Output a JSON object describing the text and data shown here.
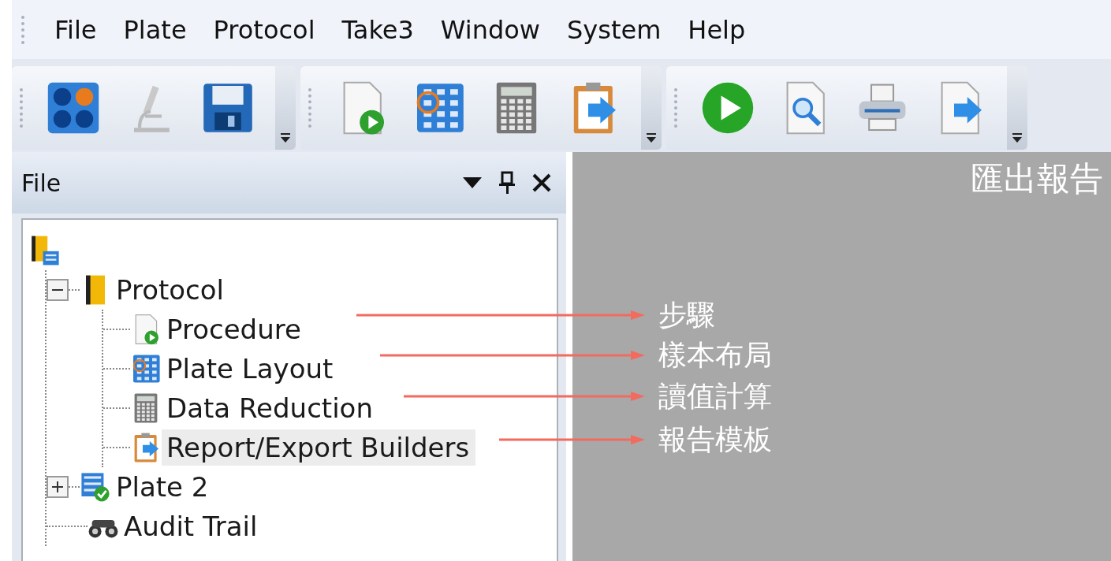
{
  "menu": [
    {
      "label": "File"
    },
    {
      "label": "Plate"
    },
    {
      "label": "Protocol"
    },
    {
      "label": "Take3"
    },
    {
      "label": "Window"
    },
    {
      "label": "System"
    },
    {
      "label": "Help"
    }
  ],
  "toolbar": [
    {
      "items": [
        {
          "kind": "wells"
        },
        {
          "kind": "microscope"
        },
        {
          "kind": "save"
        }
      ]
    },
    {
      "items": [
        {
          "kind": "procedure"
        },
        {
          "kind": "layout"
        },
        {
          "kind": "calculator"
        },
        {
          "kind": "clipboard"
        }
      ]
    },
    {
      "items": [
        {
          "kind": "play"
        },
        {
          "kind": "preview"
        },
        {
          "kind": "printer"
        },
        {
          "kind": "export"
        }
      ]
    }
  ],
  "panel": {
    "title": "File"
  },
  "tree": {
    "kind": "root",
    "children": [
      {
        "label": "Protocol",
        "kind": "folder",
        "expanded": true,
        "selected": false,
        "children": [
          {
            "label": "Procedure",
            "kind": "procedure",
            "selected": false
          },
          {
            "label": "Plate Layout",
            "kind": "layout",
            "selected": false
          },
          {
            "label": "Data Reduction",
            "kind": "calculator",
            "selected": false
          },
          {
            "label": "Report/Export Builders",
            "kind": "clipboard",
            "selected": true
          }
        ]
      },
      {
        "label": "Plate 2",
        "kind": "plate",
        "expanded": false,
        "selected": false
      },
      {
        "label": "Audit Trail",
        "kind": "binoculars",
        "selected": false
      }
    ]
  },
  "header_note": "匯出報告",
  "callouts": [
    {
      "label": "步驟"
    },
    {
      "label": "樣本布局"
    },
    {
      "label": "讀值計算"
    },
    {
      "label": "報告模板"
    }
  ]
}
